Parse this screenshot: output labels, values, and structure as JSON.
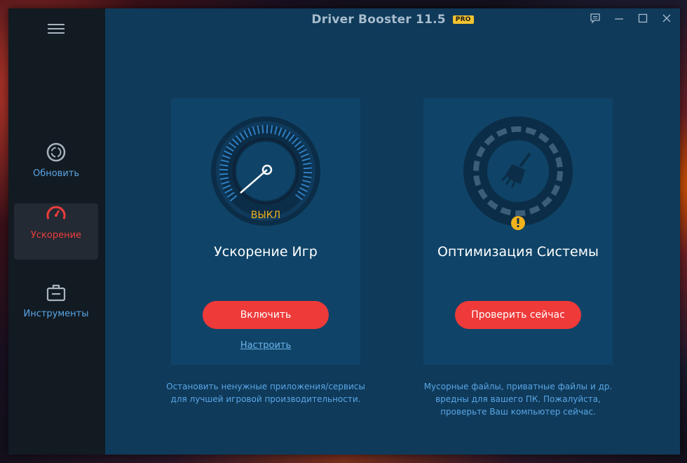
{
  "app": {
    "title": "Driver Booster 11",
    "version_suffix": ".5",
    "badge": "PRO"
  },
  "sidebar": {
    "items": [
      {
        "label": "Обновить",
        "icon": "refresh-icon"
      },
      {
        "label": "Ускорение",
        "icon": "speedometer-icon",
        "active": true
      },
      {
        "label": "Инструменты",
        "icon": "toolbox-icon"
      }
    ]
  },
  "game_boost": {
    "status": "ВЫКЛ",
    "title": "Ускорение Игр",
    "button_label": "Включить",
    "link_label": "Настроить",
    "description_line1": "Остановить ненужные приложения/сервисы",
    "description_line2": "для лучшей игровой производительности."
  },
  "system_optimize": {
    "title": "Оптимизация Системы",
    "button_label": "Проверить сейчас",
    "description_line1": "Мусорные файлы, приватные файлы и др.",
    "description_line2": "вредны для вашего ПК. Пожалуйста,",
    "description_line3": "проверьте Ваш компьютер сейчас."
  },
  "colors": {
    "accent_red": "#ef3a3a",
    "accent_blue": "#5aa6e6",
    "warning": "#f1b21c",
    "pro_badge": "#f1c230"
  }
}
